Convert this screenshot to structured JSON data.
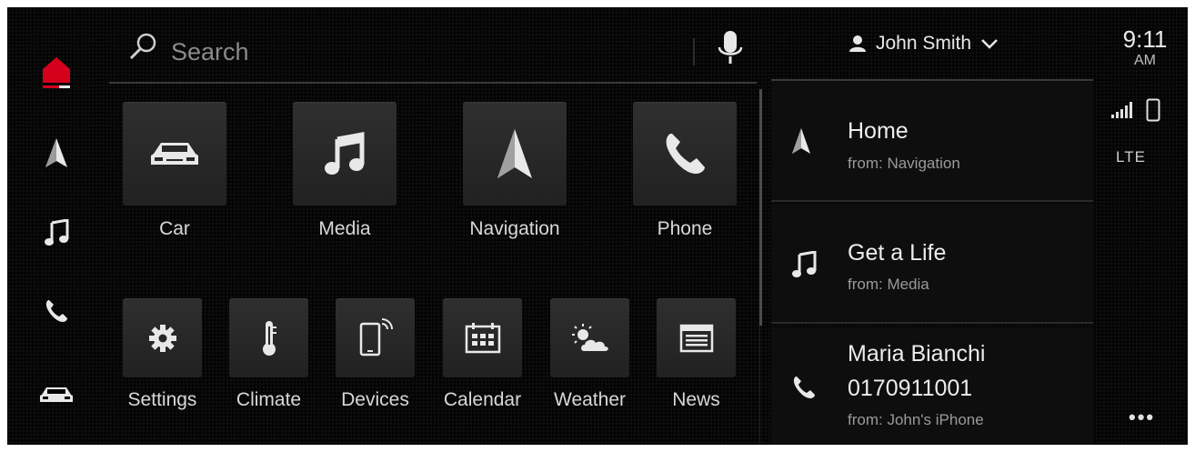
{
  "colors": {
    "accent": "#d5001c",
    "background": "#050505",
    "tile": "#2a2a2a"
  },
  "rail": {
    "items": [
      {
        "icon": "home-icon",
        "active": true
      },
      {
        "icon": "navigation-icon"
      },
      {
        "icon": "music-icon"
      },
      {
        "icon": "phone-icon"
      },
      {
        "icon": "car-icon"
      }
    ]
  },
  "search": {
    "placeholder": "Search",
    "icon": "search-icon",
    "mic_icon": "microphone-icon"
  },
  "user": {
    "name": "John Smith",
    "icon": "person-icon",
    "chevron": "chevron-down-icon"
  },
  "status": {
    "time": "9:11",
    "ampm": "AM",
    "network": "LTE",
    "signal_icon": "signal-icon",
    "phone_icon": "smartphone-icon",
    "more_icon": "more-icon"
  },
  "apps": {
    "large": [
      {
        "label": "Car",
        "icon": "car-icon"
      },
      {
        "label": "Media",
        "icon": "music-icon"
      },
      {
        "label": "Navigation",
        "icon": "navigation-icon"
      },
      {
        "label": "Phone",
        "icon": "phone-icon"
      }
    ],
    "small": [
      {
        "label": "Settings",
        "icon": "gear-icon"
      },
      {
        "label": "Climate",
        "icon": "thermometer-icon"
      },
      {
        "label": "Devices",
        "icon": "device-icon"
      },
      {
        "label": "Calendar",
        "icon": "calendar-icon"
      },
      {
        "label": "Weather",
        "icon": "weather-icon"
      },
      {
        "label": "News",
        "icon": "news-icon"
      }
    ]
  },
  "suggestions": [
    {
      "title": "Home",
      "subtitle": "from: Navigation",
      "icon": "navigation-icon"
    },
    {
      "title": "Get a Life",
      "subtitle": "from: Media",
      "icon": "music-icon"
    },
    {
      "title_line1": "Maria Bianchi",
      "title_line2": "0170911001",
      "subtitle": "from: John's iPhone",
      "icon": "phone-icon"
    }
  ]
}
